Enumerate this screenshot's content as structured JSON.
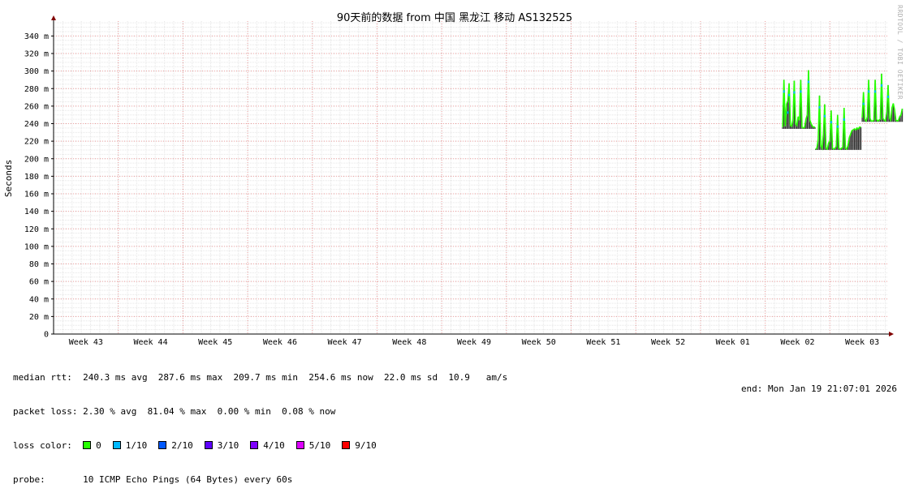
{
  "chart_data": {
    "type": "line",
    "title": "90天前的数据 from  中国 黑龙江 移动 AS132525",
    "ylabel": "Seconds",
    "watermark": "RRDTOOL / TOBI OETIKER",
    "ylim": [
      0,
      0.357
    ],
    "yticks": [
      {
        "v": 0,
        "label": "0"
      },
      {
        "v": 0.02,
        "label": "20 m"
      },
      {
        "v": 0.04,
        "label": "40 m"
      },
      {
        "v": 0.06,
        "label": "60 m"
      },
      {
        "v": 0.08,
        "label": "80 m"
      },
      {
        "v": 0.1,
        "label": "100 m"
      },
      {
        "v": 0.12,
        "label": "120 m"
      },
      {
        "v": 0.14,
        "label": "140 m"
      },
      {
        "v": 0.16,
        "label": "160 m"
      },
      {
        "v": 0.18,
        "label": "180 m"
      },
      {
        "v": 0.2,
        "label": "200 m"
      },
      {
        "v": 0.22,
        "label": "220 m"
      },
      {
        "v": 0.24,
        "label": "240 m"
      },
      {
        "v": 0.26,
        "label": "260 m"
      },
      {
        "v": 0.28,
        "label": "280 m"
      },
      {
        "v": 0.3,
        "label": "300 m"
      },
      {
        "v": 0.32,
        "label": "320 m"
      },
      {
        "v": 0.34,
        "label": "340 m"
      }
    ],
    "x_weeks": 12.9,
    "xticks": [
      {
        "w": 0.5,
        "label": "Week 43"
      },
      {
        "w": 1.5,
        "label": "Week 44"
      },
      {
        "w": 2.5,
        "label": "Week 45"
      },
      {
        "w": 3.5,
        "label": "Week 46"
      },
      {
        "w": 4.5,
        "label": "Week 47"
      },
      {
        "w": 5.5,
        "label": "Week 48"
      },
      {
        "w": 6.5,
        "label": "Week 49"
      },
      {
        "w": 7.5,
        "label": "Week 50"
      },
      {
        "w": 8.5,
        "label": "Week 51"
      },
      {
        "w": 9.5,
        "label": "Week 52"
      },
      {
        "w": 10.5,
        "label": "Week 01"
      },
      {
        "w": 11.5,
        "label": "Week 02"
      },
      {
        "w": 12.5,
        "label": "Week 03"
      }
    ],
    "series": [
      {
        "segments": [
          {
            "x": [
              11.27,
              11.29,
              11.31,
              11.33,
              11.35,
              11.37,
              11.39,
              11.41,
              11.43,
              11.45,
              11.47,
              11.49,
              11.51,
              11.53,
              11.55,
              11.57,
              11.59,
              11.61,
              11.63,
              11.65,
              11.67,
              11.69,
              11.71,
              11.73,
              11.75,
              11.77
            ],
            "y": [
              0.236,
              0.29,
              0.237,
              0.262,
              0.266,
              0.286,
              0.238,
              0.237,
              0.245,
              0.289,
              0.24,
              0.238,
              0.248,
              0.244,
              0.29,
              0.236,
              0.235,
              0.236,
              0.245,
              0.25,
              0.301,
              0.244,
              0.24,
              0.237,
              0.236,
              0.236
            ]
          },
          {
            "x": [
              11.78,
              11.8,
              11.82,
              11.84,
              11.86,
              11.88,
              11.9,
              11.92,
              11.94,
              11.96,
              11.98,
              12.0,
              12.02,
              12.04,
              12.06,
              12.08,
              12.1,
              12.12,
              12.14,
              12.16,
              12.18,
              12.2,
              12.22,
              12.24,
              12.26,
              12.28,
              12.3,
              12.32,
              12.34,
              12.36,
              12.38,
              12.4,
              12.42,
              12.44,
              12.46,
              12.48
            ],
            "y": [
              0.211,
              0.212,
              0.222,
              0.272,
              0.215,
              0.212,
              0.228,
              0.262,
              0.212,
              0.211,
              0.218,
              0.22,
              0.255,
              0.212,
              0.211,
              0.212,
              0.214,
              0.25,
              0.212,
              0.211,
              0.212,
              0.213,
              0.258,
              0.212,
              0.211,
              0.215,
              0.224,
              0.228,
              0.232,
              0.233,
              0.234,
              0.233,
              0.235,
              0.234,
              0.236,
              0.236
            ]
          },
          {
            "x": [
              12.5,
              12.52,
              12.54,
              12.56,
              12.58,
              12.6,
              12.62,
              12.64,
              12.66,
              12.68,
              12.7,
              12.72,
              12.74,
              12.76,
              12.78,
              12.8,
              12.82,
              12.84,
              12.86,
              12.88,
              12.9,
              12.92,
              12.94,
              12.96,
              12.98,
              13.0,
              13.02,
              13.04,
              13.06,
              13.08,
              13.1,
              13.12
            ],
            "y": [
              0.247,
              0.276,
              0.245,
              0.243,
              0.248,
              0.29,
              0.246,
              0.243,
              0.243,
              0.244,
              0.29,
              0.245,
              0.243,
              0.244,
              0.245,
              0.297,
              0.246,
              0.244,
              0.243,
              0.253,
              0.284,
              0.246,
              0.244,
              0.258,
              0.263,
              0.256,
              0.244,
              0.243,
              0.244,
              0.248,
              0.25,
              0.257
            ]
          }
        ]
      }
    ]
  },
  "legend": {
    "median_rtt": "median rtt:  240.3 ms avg  287.6 ms max  209.7 ms min  254.6 ms now  22.0 ms sd  10.9   am/s",
    "packet_loss": "packet loss: 2.30 % avg  81.04 % max  0.00 % min  0.08 % now",
    "loss_color_label": "loss color:  ",
    "loss_colors": [
      {
        "label": "0",
        "color": "#26ff00"
      },
      {
        "label": "1/10",
        "color": "#00b8ff"
      },
      {
        "label": "2/10",
        "color": "#0059ff"
      },
      {
        "label": "3/10",
        "color": "#5e00ff"
      },
      {
        "label": "4/10",
        "color": "#7e00ff"
      },
      {
        "label": "5/10",
        "color": "#dd00ff"
      },
      {
        "label": "9/10",
        "color": "#ff0000"
      }
    ],
    "probe": "probe:       10 ICMP Echo Pings (64 Bytes) every 60s",
    "end": "end: Mon Jan 19 21:07:01 2026"
  }
}
